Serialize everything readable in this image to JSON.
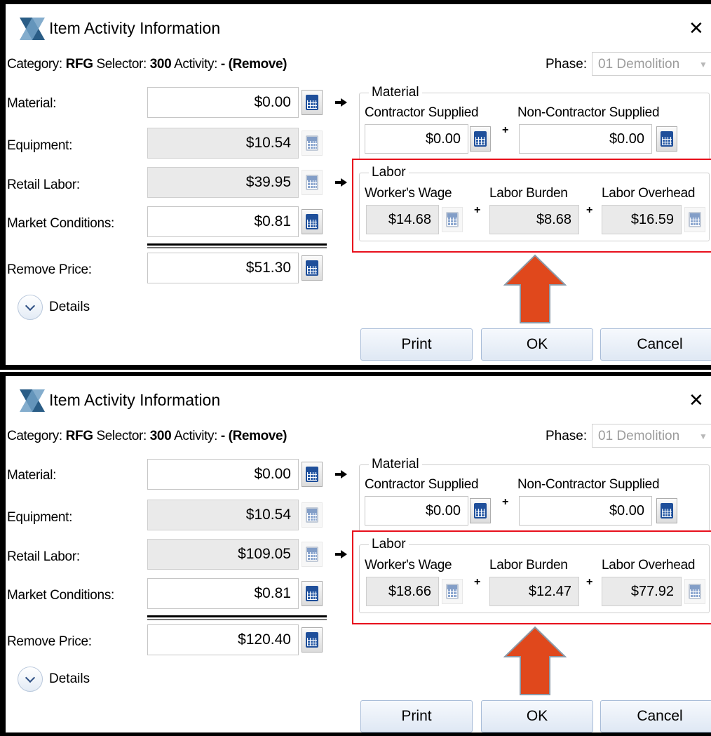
{
  "colors": {
    "highlight": "#e8101c",
    "arrow_fill": "#e0481c",
    "arrow_stroke": "#8c9aa8",
    "readonly_field": "#eaeaea"
  },
  "icons": [
    "app-logo-icon",
    "close-icon",
    "calculator-icon",
    "right-arrow-icon",
    "chevron-down-icon",
    "up-arrow-icon"
  ],
  "dialogs": [
    {
      "title": "Item Activity Information",
      "close_glyph": "✕",
      "category_label": "Category:",
      "category_value": "RFG",
      "selector_label": "Selector:",
      "selector_value": "300",
      "activity_label": "Activity:",
      "activity_value": "- (Remove)",
      "phase_label": "Phase:",
      "phase_value": "01 Demolition",
      "rows": {
        "material_label": "Material:",
        "material_value": "$0.00",
        "equipment_label": "Equipment:",
        "equipment_value": "$10.54",
        "retail_labor_label": "Retail Labor:",
        "retail_labor_value": "$39.95",
        "market_label": "Market Conditions:",
        "market_value": "$0.81",
        "remove_price_label": "Remove Price:",
        "remove_price_value": "$51.30"
      },
      "material_group": {
        "title": "Material",
        "contractor_label": "Contractor Supplied",
        "contractor_value": "$0.00",
        "non_contractor_label": "Non-Contractor Supplied",
        "non_contractor_value": "$0.00"
      },
      "labor_group": {
        "title": "Labor",
        "wage_label": "Worker's Wage",
        "wage_value": "$14.68",
        "burden_label": "Labor Burden",
        "burden_value": "$8.68",
        "overhead_label": "Labor Overhead",
        "overhead_value": "$16.59"
      },
      "plus": "+",
      "details_label": "Details",
      "buttons": {
        "print": "Print",
        "ok": "OK",
        "cancel": "Cancel"
      }
    },
    {
      "title": "Item Activity Information",
      "close_glyph": "✕",
      "category_label": "Category:",
      "category_value": "RFG",
      "selector_label": "Selector:",
      "selector_value": "300",
      "activity_label": "Activity:",
      "activity_value": "- (Remove)",
      "phase_label": "Phase:",
      "phase_value": "01 Demolition",
      "rows": {
        "material_label": "Material:",
        "material_value": "$0.00",
        "equipment_label": "Equipment:",
        "equipment_value": "$10.54",
        "retail_labor_label": "Retail Labor:",
        "retail_labor_value": "$109.05",
        "market_label": "Market Conditions:",
        "market_value": "$0.81",
        "remove_price_label": "Remove Price:",
        "remove_price_value": "$120.40"
      },
      "material_group": {
        "title": "Material",
        "contractor_label": "Contractor Supplied",
        "contractor_value": "$0.00",
        "non_contractor_label": "Non-Contractor Supplied",
        "non_contractor_value": "$0.00"
      },
      "labor_group": {
        "title": "Labor",
        "wage_label": "Worker's Wage",
        "wage_value": "$18.66",
        "burden_label": "Labor Burden",
        "burden_value": "$12.47",
        "overhead_label": "Labor Overhead",
        "overhead_value": "$77.92"
      },
      "plus": "+",
      "details_label": "Details",
      "buttons": {
        "print": "Print",
        "ok": "OK",
        "cancel": "Cancel"
      }
    }
  ]
}
